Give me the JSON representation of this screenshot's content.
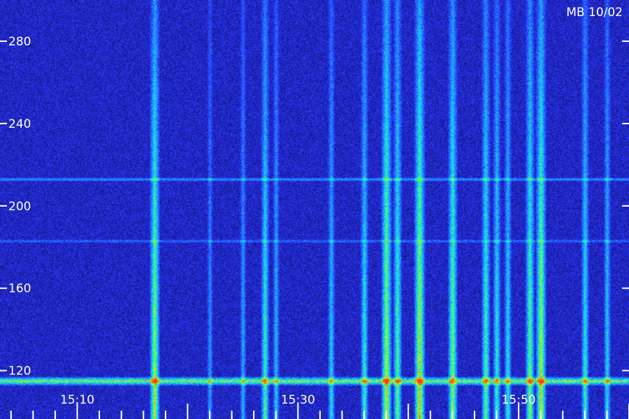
{
  "station_label": "MB 10/02",
  "chart_data": {
    "type": "heatmap",
    "title": "",
    "xlabel": "",
    "ylabel": "",
    "colormap": [
      "#0a0a3c",
      "#1a1aa0",
      "#2a3cff",
      "#1f8cff",
      "#18d0ff",
      "#19ff9a",
      "#7dff2a",
      "#ffe21a",
      "#ff3b1a"
    ],
    "y_axis": {
      "range": [
        108,
        300
      ],
      "ticks": [
        120,
        160,
        200,
        240,
        280
      ],
      "tick_labels": [
        "120",
        "160",
        "200",
        "240",
        "280"
      ]
    },
    "x_axis": {
      "range": [
        "15:03",
        "16:00"
      ],
      "labeled_ticks": [
        "15:10",
        "15:30",
        "15:50"
      ]
    },
    "features": {
      "vertical_bursts": [
        {
          "time": "15:17",
          "strength": 0.85
        },
        {
          "time": "15:22",
          "strength": 0.35
        },
        {
          "time": "15:25",
          "strength": 0.4
        },
        {
          "time": "15:27",
          "strength": 0.65
        },
        {
          "time": "15:28",
          "strength": 0.45
        },
        {
          "time": "15:33",
          "strength": 0.5
        },
        {
          "time": "15:36",
          "strength": 0.6
        },
        {
          "time": "15:38",
          "strength": 0.9
        },
        {
          "time": "15:39",
          "strength": 0.7
        },
        {
          "time": "15:41",
          "strength": 0.95
        },
        {
          "time": "15:44",
          "strength": 0.8
        },
        {
          "time": "15:47",
          "strength": 0.7
        },
        {
          "time": "15:48",
          "strength": 0.6
        },
        {
          "time": "15:49",
          "strength": 0.55
        },
        {
          "time": "15:51",
          "strength": 0.75
        },
        {
          "time": "15:52",
          "strength": 0.9
        },
        {
          "time": "15:56",
          "strength": 0.6
        },
        {
          "time": "15:58",
          "strength": 0.5
        }
      ],
      "horizontal_lines": [
        {
          "value": 213,
          "strength": 0.55
        },
        {
          "value": 183,
          "strength": 0.35
        }
      ],
      "bottom_band": {
        "value": 115,
        "strength": 0.8
      }
    }
  }
}
